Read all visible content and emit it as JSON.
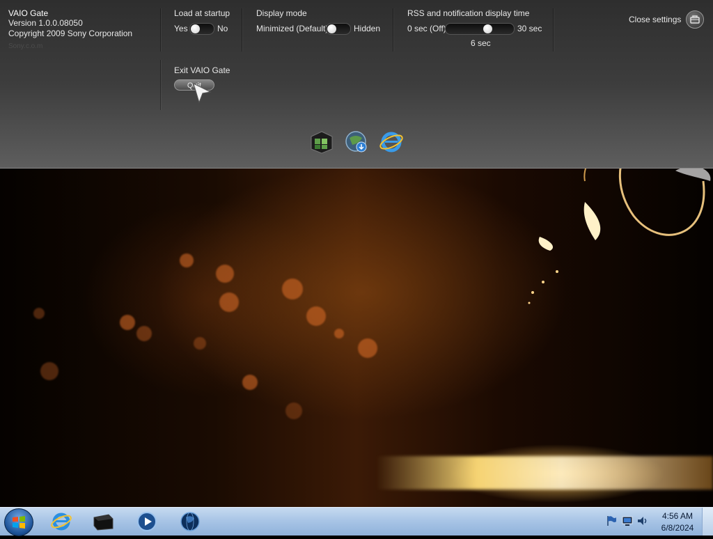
{
  "app": {
    "name": "VAIO Gate",
    "version": "Version 1.0.0.08050",
    "copyright": "Copyright 2009 Sony Corporation",
    "faded_text": "Sony.c.o.m"
  },
  "settings": {
    "load_at_startup": {
      "label": "Load at startup",
      "on_label": "Yes",
      "off_label": "No",
      "value": "Yes"
    },
    "display_mode": {
      "label": "Display mode",
      "on_label": "Minimized (Default)",
      "off_label": "Hidden",
      "value": "Minimized (Default)"
    },
    "rss_time": {
      "label": "RSS and notification display time",
      "min_label": "0 sec (Off)",
      "max_label": "30 sec",
      "value_label": "6 sec",
      "value_sec": 6,
      "min_sec": 0,
      "max_sec": 30
    },
    "exit": {
      "label": "Exit VAIO Gate",
      "button": "Quit"
    },
    "close_label": "Close settings"
  },
  "dock": {
    "items": [
      {
        "icon": "media-gallery-icon"
      },
      {
        "icon": "vaio-update-icon"
      },
      {
        "icon": "internet-explorer-icon"
      }
    ]
  },
  "taskbar": {
    "pinned": [
      {
        "icon": "internet-explorer-icon"
      },
      {
        "icon": "vaio-gate-icon"
      },
      {
        "icon": "media-player-icon"
      },
      {
        "icon": "globe-icon"
      }
    ],
    "tray": [
      {
        "icon": "action-center-flag-icon"
      },
      {
        "icon": "network-icon"
      },
      {
        "icon": "volume-icon"
      }
    ],
    "clock": {
      "time": "4:56 AM",
      "date": "6/8/2024"
    }
  },
  "colors": {
    "panel_top": "#2e2e2e",
    "panel_bottom": "#5e5e5e",
    "taskbar": "#a9c5e6",
    "wallpaper_accent": "#ff9c30"
  }
}
